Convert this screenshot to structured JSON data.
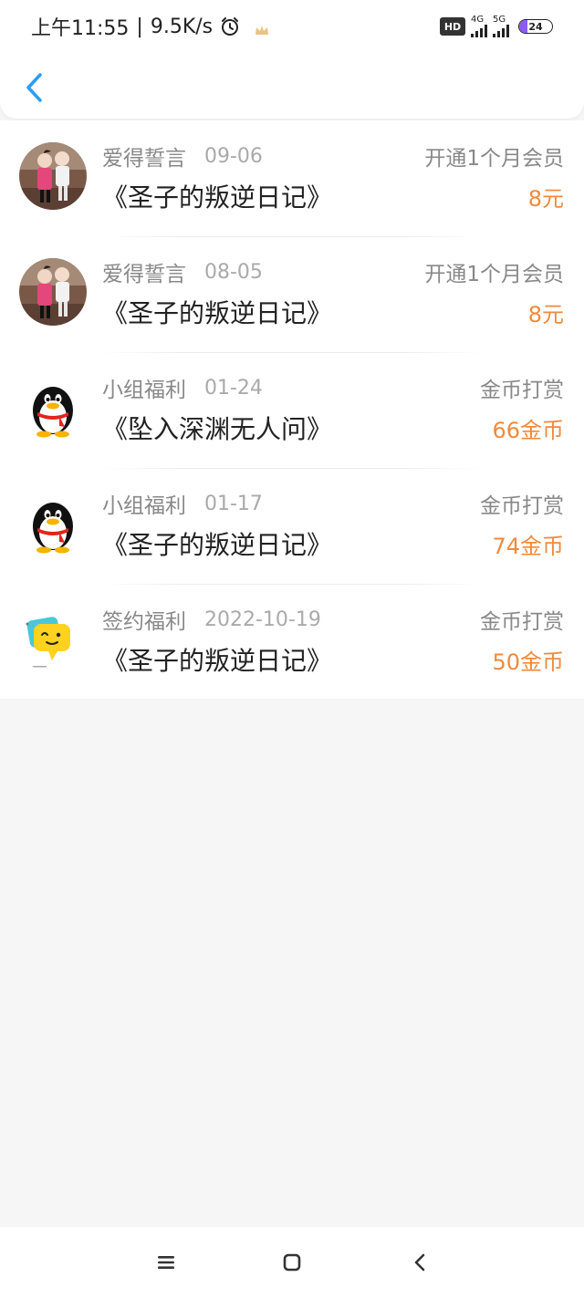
{
  "status_bar": {
    "time": "上午11:55",
    "separator": "|",
    "speed": "9.5K/s",
    "hd_label": "HD",
    "net1_label": "4G",
    "net2_label": "5G",
    "battery": "24",
    "battery_level": 0.24,
    "battery_color": "#8b5cf6"
  },
  "header": {
    "back_icon": "chevron-left-icon",
    "accent_color": "#2a9df4"
  },
  "rewards": [
    {
      "avatar": "photo-two-children",
      "sender": "爱得誓言",
      "date": "09-06",
      "book": "《圣子的叛逆日记》",
      "type": "开通1个月会员",
      "amount": "8元"
    },
    {
      "avatar": "photo-two-children",
      "sender": "爱得誓言",
      "date": "08-05",
      "book": "《圣子的叛逆日记》",
      "type": "开通1个月会员",
      "amount": "8元"
    },
    {
      "avatar": "penguin",
      "sender": "小组福利",
      "date": "01-24",
      "book": "《坠入深渊无人问》",
      "type": "金币打赏",
      "amount": "66金币"
    },
    {
      "avatar": "penguin",
      "sender": "小组福利",
      "date": "01-17",
      "book": "《圣子的叛逆日记》",
      "type": "金币打赏",
      "amount": "74金币"
    },
    {
      "avatar": "speech-bubble-emoji",
      "sender": "签约福利",
      "date": "2022-10-19",
      "book": "《圣子的叛逆日记》",
      "type": "金币打赏",
      "amount": "50金币"
    }
  ],
  "amount_color": "#f08a3c",
  "nav_bar": {
    "menu_icon": "menu-icon",
    "home_icon": "home-square-icon",
    "back_icon": "back-chevron-icon"
  }
}
